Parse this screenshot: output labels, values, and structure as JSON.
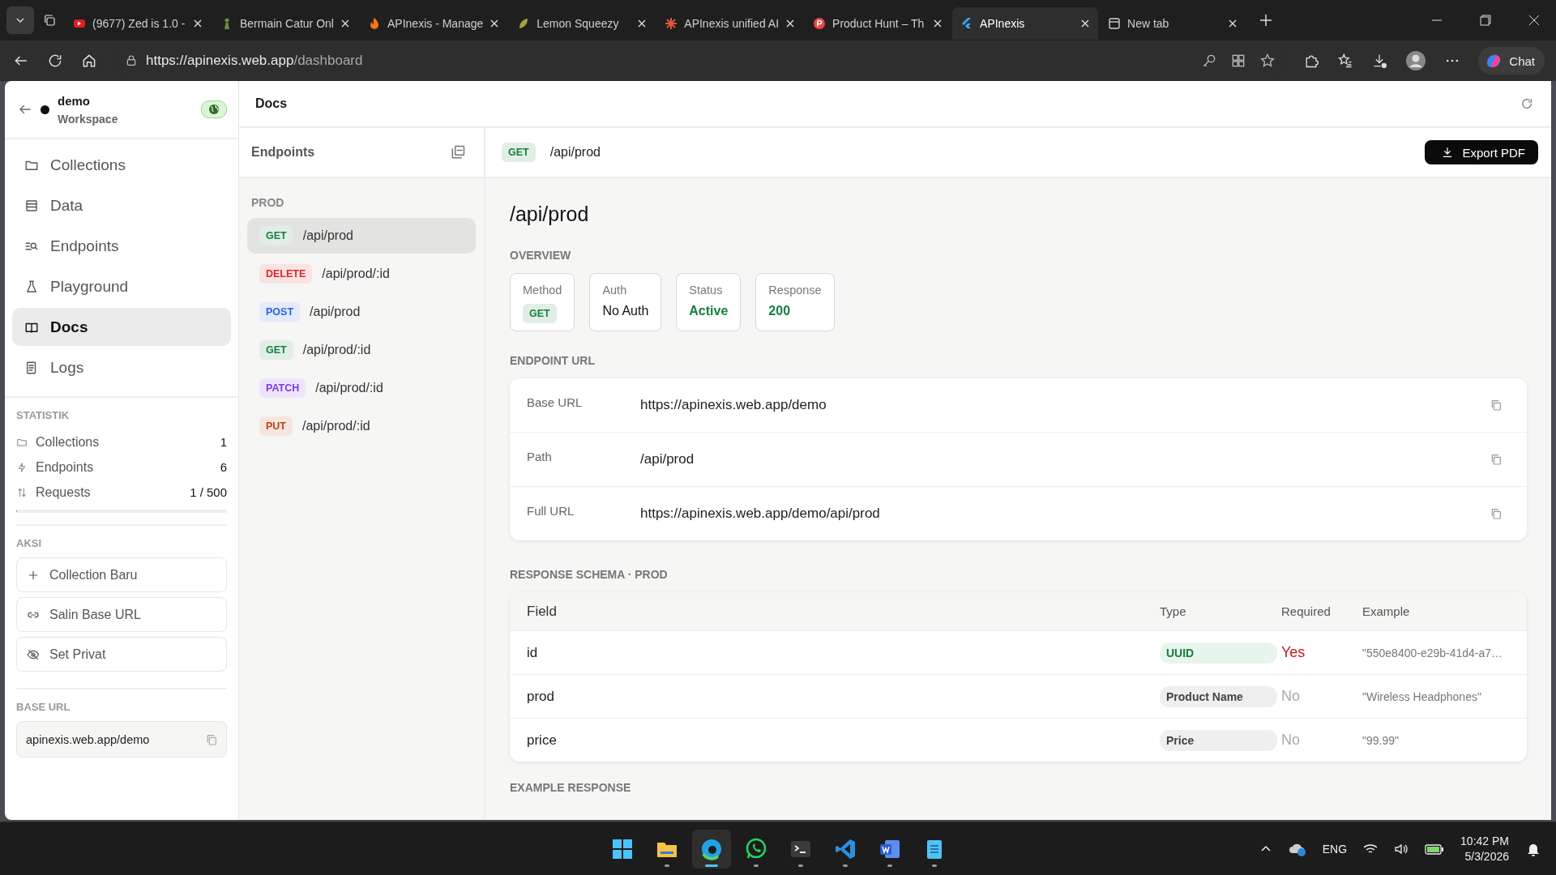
{
  "browser": {
    "tabs": [
      {
        "title": "(9677) Zed is 1.0 -",
        "kind": "video",
        "selected": false
      },
      {
        "title": "Bermain Catur Onl",
        "kind": "pawn",
        "selected": false
      },
      {
        "title": "APInexis - Manage",
        "kind": "flame",
        "selected": false
      },
      {
        "title": "Lemon Squeezy",
        "kind": "leaf",
        "selected": false
      },
      {
        "title": "APInexis unified AI",
        "kind": "burst",
        "selected": false
      },
      {
        "title": "Product Hunt – Th",
        "kind": "circle",
        "selected": false
      },
      {
        "title": "APInexis",
        "kind": "flutter",
        "selected": true
      },
      {
        "title": "New tab",
        "kind": "page",
        "selected": false
      }
    ],
    "address": {
      "host": "https://apinexis.web.app",
      "path": "/dashboard"
    },
    "chat_button": "Chat"
  },
  "sidebar": {
    "workspace": {
      "name": "demo",
      "subtitle": "Workspace",
      "public": true
    },
    "nav": [
      {
        "label": "Collections",
        "selected": false
      },
      {
        "label": "Data",
        "selected": false
      },
      {
        "label": "Endpoints",
        "selected": false
      },
      {
        "label": "Playground",
        "selected": false
      },
      {
        "label": "Docs",
        "selected": true
      },
      {
        "label": "Logs",
        "selected": false
      }
    ],
    "stats_title": "STATISTIK",
    "stats": [
      {
        "label": "Collections",
        "value": "1"
      },
      {
        "label": "Endpoints",
        "value": "6"
      },
      {
        "label": "Requests",
        "value": "1 / 500"
      }
    ],
    "requests_usage": {
      "level": 0.002
    },
    "actions_title": "AKSI",
    "actions": [
      {
        "label": "Collection Baru"
      },
      {
        "label": "Salin Base URL"
      },
      {
        "label": "Set Privat"
      }
    ],
    "base_url_title": "BASE URL",
    "base_url": "apinexis.web.app/demo"
  },
  "header": {
    "title": "Docs"
  },
  "endpoints_panel": {
    "title": "Endpoints",
    "group": "PROD",
    "items": [
      {
        "method": "GET",
        "color": "#15803d",
        "path": "/api/prod",
        "selected": true
      },
      {
        "method": "DELETE",
        "color": "#dc2626",
        "path": "/api/prod/:id",
        "selected": false
      },
      {
        "method": "POST",
        "color": "#2563eb",
        "path": "/api/prod",
        "selected": false
      },
      {
        "method": "GET",
        "color": "#15803d",
        "path": "/api/prod/:id",
        "selected": false
      },
      {
        "method": "PATCH",
        "color": "#7c3aed",
        "path": "/api/prod/:id",
        "selected": false
      },
      {
        "method": "PUT",
        "color": "#c2410c",
        "path": "/api/prod/:id",
        "selected": false
      }
    ]
  },
  "detail": {
    "method": "GET",
    "path": "/api/prod",
    "export_button": "Export PDF",
    "heading": "/api/prod",
    "overview_title": "OVERVIEW",
    "overview": [
      {
        "label": "Method",
        "value": "GET",
        "kind": "badge"
      },
      {
        "label": "Auth",
        "value": "No Auth",
        "kind": "text"
      },
      {
        "label": "Status",
        "value": "Active",
        "kind": "positive"
      },
      {
        "label": "Response",
        "value": "200",
        "kind": "positive"
      }
    ],
    "endpoint_url_title": "ENDPOINT URL",
    "urls": [
      {
        "label": "Base URL",
        "value": "https://apinexis.web.app/demo"
      },
      {
        "label": "Path",
        "value": "/api/prod"
      },
      {
        "label": "Full URL",
        "value": "https://apinexis.web.app/demo/api/prod"
      }
    ],
    "schema_title": "RESPONSE SCHEMA · PROD",
    "schema": {
      "columns": [
        "Field",
        "Type",
        "Required",
        "Example"
      ],
      "rows": [
        {
          "field": "id",
          "type": "UUID",
          "primary": true,
          "required": true,
          "required_text": "Yes",
          "example": "\"550e8400-e29b-41d4-a7…"
        },
        {
          "field": "prod",
          "type": "Product Name",
          "primary": false,
          "required": false,
          "required_text": "No",
          "example": "\"Wireless Headphones\""
        },
        {
          "field": "price",
          "type": "Price",
          "primary": false,
          "required": false,
          "required_text": "No",
          "example": "\"99.99\""
        }
      ]
    },
    "example_title": "EXAMPLE RESPONSE"
  },
  "taskbar": {
    "apps": [
      {
        "kind": "start",
        "running": false,
        "active": false
      },
      {
        "kind": "files",
        "running": true,
        "active": false
      },
      {
        "kind": "browser",
        "running": true,
        "active": true
      },
      {
        "kind": "chat",
        "running": true,
        "active": false
      },
      {
        "kind": "terminal",
        "running": true,
        "active": false
      },
      {
        "kind": "editor",
        "running": true,
        "active": false
      },
      {
        "kind": "word",
        "running": true,
        "active": false
      },
      {
        "kind": "notes",
        "running": true,
        "active": false
      }
    ],
    "language": "ENG",
    "time": "10:42 PM",
    "date": "5/3/2026"
  }
}
